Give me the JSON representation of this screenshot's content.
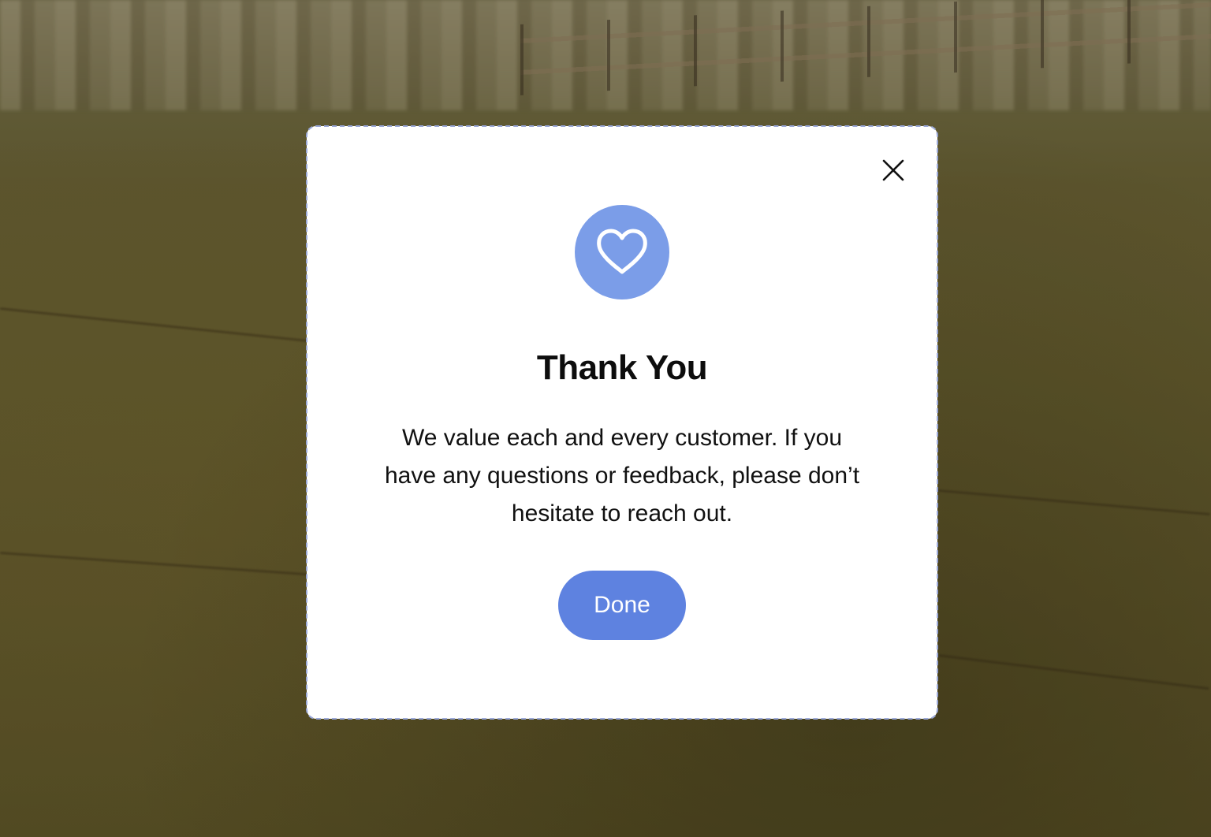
{
  "dialog": {
    "title": "Thank You",
    "message": "We value each and every customer. If you have any questions or feedback, please don’t hesitate to reach out.",
    "icon": "heart-icon",
    "close_icon": "close-icon",
    "done_label": "Done"
  },
  "colors": {
    "accent": "#5e82e0",
    "icon_circle": "#7b9de8",
    "dialog_background": "#ffffff",
    "dialog_border": "#9aa8d8"
  }
}
